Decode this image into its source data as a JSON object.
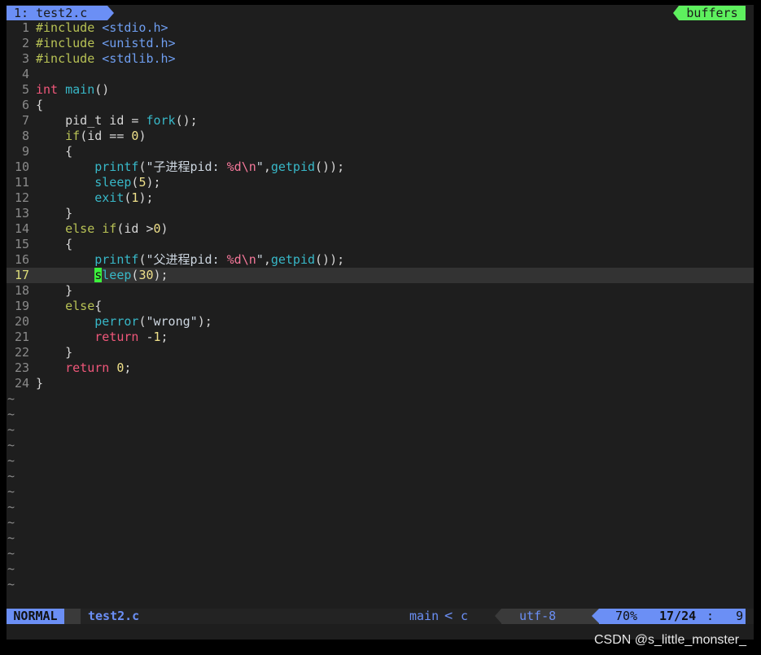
{
  "tabline": {
    "active_tab": "1: test2.c",
    "buffers_label": "buffers"
  },
  "code": [
    {
      "n": "1"
    },
    {
      "n": "2"
    },
    {
      "n": "3"
    },
    {
      "n": "4"
    },
    {
      "n": "5"
    },
    {
      "n": "6"
    },
    {
      "n": "7"
    },
    {
      "n": "8"
    },
    {
      "n": "9"
    },
    {
      "n": "10"
    },
    {
      "n": "11"
    },
    {
      "n": "12"
    },
    {
      "n": "13"
    },
    {
      "n": "14"
    },
    {
      "n": "15"
    },
    {
      "n": "16"
    },
    {
      "n": "17"
    },
    {
      "n": "18"
    },
    {
      "n": "19"
    },
    {
      "n": "20"
    },
    {
      "n": "21"
    },
    {
      "n": "22"
    },
    {
      "n": "23"
    },
    {
      "n": "24"
    }
  ],
  "empty_line_marker": "~",
  "statusline": {
    "mode": "NORMAL",
    "filename": "test2.c",
    "function": "main",
    "separator": "<",
    "filetype": "c",
    "encoding": "utf-8",
    "percent": "70%",
    "position": "17/24",
    "colon": ":",
    "column": "9"
  },
  "watermark": "CSDN @s_little_monster_",
  "colors": {
    "accent": "#6b8ff5",
    "buffers": "#5ef05e",
    "background": "#1e1e1e",
    "cursor": "#3cf23c"
  }
}
